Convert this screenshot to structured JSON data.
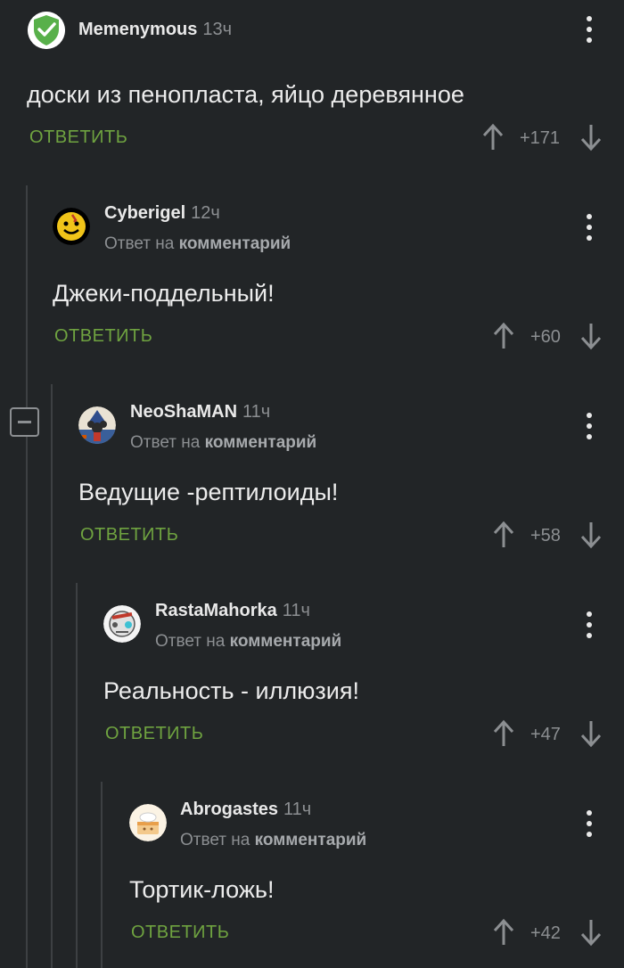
{
  "collapse": {
    "icon": "minus-square-icon"
  },
  "comments": [
    {
      "author": "Memenymous",
      "time": "13ч",
      "reply_to": null,
      "text": "доски из пенопласта, яйцо деревянное",
      "reply_label": "ОТВЕТИТЬ",
      "votes": "+171",
      "avatar_icon": "verified-checkmark-avatar",
      "avatar_color": "#58b04a"
    },
    {
      "author": "Cyberigel",
      "time": "12ч",
      "reply_prefix": "Ответ на",
      "reply_target": "комментарий",
      "text": "Джеки-поддельный!",
      "reply_label": "ОТВЕТИТЬ",
      "votes": "+60",
      "avatar_icon": "watchmen-smiley-avatar",
      "avatar_color": "#f0c419"
    },
    {
      "author": "NeoShaMAN",
      "time": "11ч",
      "reply_prefix": "Ответ на",
      "reply_target": "комментарий",
      "text": "Ведущие -рептилоиды!",
      "reply_label": "ОТВЕТИТЬ",
      "votes": "+58",
      "avatar_icon": "wizard-mouse-avatar",
      "avatar_color": "#3a5f9a"
    },
    {
      "author": "RastaMahorka",
      "time": "11ч",
      "reply_prefix": "Ответ на",
      "reply_target": "комментарий",
      "text": "Реальность - иллюзия!",
      "reply_label": "ОТВЕТИТЬ",
      "votes": "+47",
      "avatar_icon": "robot-face-avatar",
      "avatar_color": "#e8e8e8"
    },
    {
      "author": "Abrogastes",
      "time": "11ч",
      "reply_prefix": "Ответ на",
      "reply_target": "комментарий",
      "text": "Тортик-ложь!",
      "reply_label": "ОТВЕТИТЬ",
      "votes": "+42",
      "avatar_icon": "cake-avatar",
      "avatar_color": "#f3c98b"
    }
  ],
  "colors": {
    "background": "#222527",
    "accent_green": "#6fa340",
    "muted": "#8c8f92"
  }
}
